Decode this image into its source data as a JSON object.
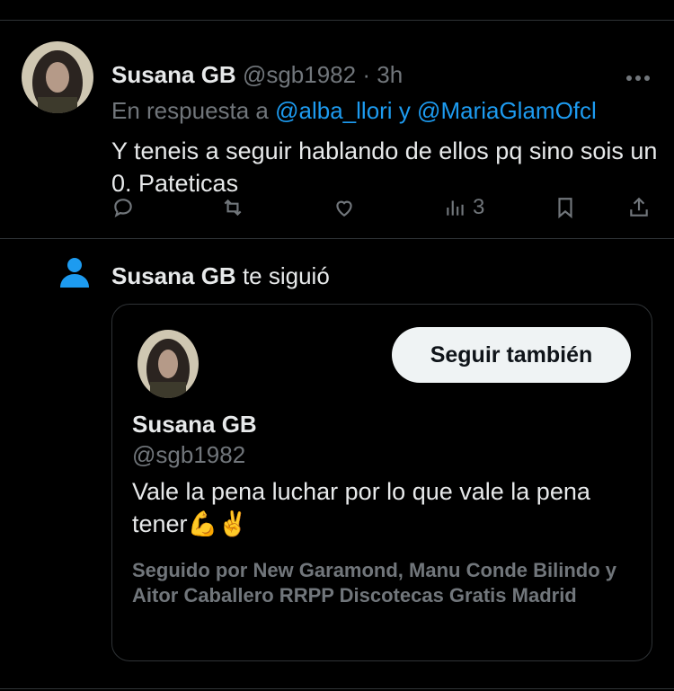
{
  "tweet": {
    "author_name": "Susana GB",
    "author_handle": "@sgb1982",
    "separator": "·",
    "time": "3h",
    "more_icon": "more-horizontal-icon",
    "reply_prefix": "En respuesta a ",
    "reply_mention_1": "@alba_llori",
    "reply_joiner": " y ",
    "reply_mention_2": "@MariaGlamOfcl",
    "text": "Y teneis a seguir hablando de ellos pq sino sois un 0. Pateticas",
    "actions": {
      "reply_icon": "reply-icon",
      "retweet_icon": "retweet-icon",
      "like_icon": "heart-icon",
      "views_icon": "views-icon",
      "views_count": "3",
      "bookmark_icon": "bookmark-icon",
      "share_icon": "share-icon"
    }
  },
  "follow_notification": {
    "icon": "person-icon",
    "name": "Susana GB",
    "action_text": " te siguió",
    "card": {
      "follow_button_label": "Seguir también",
      "name": "Susana GB",
      "handle": "@sgb1982",
      "bio": "Vale la pena luchar por lo que vale la pena tener💪✌️",
      "followed_by": "Seguido por New Garamond, Manu Conde Bilindo y Aitor Caballero RRPP Discotecas Gratis Madrid"
    }
  },
  "colors": {
    "background": "#000000",
    "text_primary": "#e7e9ea",
    "text_secondary": "#71767b",
    "link": "#1d9bf0",
    "divider": "#2f3336",
    "button_bg": "#eff3f4"
  }
}
